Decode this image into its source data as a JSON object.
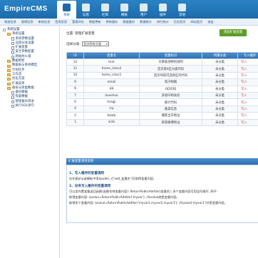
{
  "header": {
    "logo": "EmpireCMS",
    "nav": [
      {
        "label": "系统",
        "icon": "system-icon",
        "active": true
      },
      {
        "label": "信息",
        "icon": "info-icon"
      },
      {
        "label": "栏目",
        "icon": "column-icon"
      },
      {
        "label": "模板",
        "icon": "template-icon"
      },
      {
        "label": "用户",
        "icon": "user-icon"
      },
      {
        "label": "插件",
        "icon": "plugin-icon"
      },
      {
        "label": "其他",
        "icon": "other-icon"
      }
    ]
  },
  "subnav": [
    "增加信息",
    "管理信息",
    "审核信息",
    "签发信息",
    "管理评论",
    "数据更新",
    "更新缓存",
    "数据备份",
    "数据统计",
    "排行统计",
    "后台首页",
    "网站首页",
    "退出"
  ],
  "sidebar": {
    "items": [
      {
        "label": "系统设置",
        "kind": "root"
      },
      {
        "label": "系统设置",
        "kind": "folder",
        "indent": 1
      },
      {
        "label": "系统参数设置",
        "kind": "doc",
        "indent": 2
      },
      {
        "label": "远程分发设置",
        "kind": "doc",
        "indent": 2
      },
      {
        "label": "扩展变量",
        "kind": "doc",
        "indent": 2
      },
      {
        "label": "安全参数配置",
        "kind": "doc",
        "indent": 2
      },
      {
        "label": "网站防火墙",
        "kind": "doc",
        "indent": 2
      },
      {
        "label": "数据更新",
        "kind": "folder",
        "indent": 1
      },
      {
        "label": "数据表与系统模型",
        "kind": "folder",
        "indent": 1
      },
      {
        "label": "计划任务",
        "kind": "folder",
        "indent": 1
      },
      {
        "label": "工作流",
        "kind": "folder",
        "indent": 1
      },
      {
        "label": "优化方案",
        "kind": "folder",
        "indent": 1
      },
      {
        "label": "扩展菜单",
        "kind": "folder",
        "indent": 1
      },
      {
        "label": "备份与恢复数据",
        "kind": "folder",
        "indent": 1
      },
      {
        "label": "备份数据",
        "kind": "doc",
        "indent": 2
      },
      {
        "label": "恢复数据",
        "kind": "doc",
        "indent": 2
      },
      {
        "label": "管理备份目录",
        "kind": "doc",
        "indent": 2
      },
      {
        "label": "执行SQL语句",
        "kind": "doc",
        "indent": 2
      }
    ]
  },
  "main": {
    "breadcrumb": "位置: 管理扩展变量",
    "add_button": "增加扩展变量",
    "filter_label": "选择分类:",
    "filter_value": "显示所有分类",
    "columns": [
      "ID",
      "变量名",
      "变量标识",
      "所属分类",
      "写入缓存"
    ],
    "rows": [
      [
        "12",
        "text",
        "文章底部特别说明",
        "未分类",
        "写入"
      ],
      [
        "11",
        "home_class2",
        "首页第4区分类代码",
        "未分类",
        "写入"
      ],
      [
        "10",
        "home_class1",
        "首页导航可选择区的代码",
        "未分类",
        "写入"
      ],
      [
        "9",
        "email",
        "电子邮箱",
        "未分类",
        "写入"
      ],
      [
        "8",
        "qq",
        "QQ号码",
        "未分类",
        "写入"
      ],
      [
        "7",
        "duoshuo",
        "多说ID的站名",
        "未分类",
        "写入"
      ],
      [
        "6",
        "tongji",
        "统计代码",
        "未分类",
        "写入"
      ],
      [
        "4",
        "icp",
        "备案信息",
        "未分类",
        "写入"
      ],
      [
        "2",
        "bowb",
        "播客主页地址",
        "未分类",
        "写入"
      ],
      [
        "1",
        "sinb",
        "新浪微博地址",
        "未分类",
        "写入"
      ]
    ],
    "info": {
      "title": "扩展变量调用说明",
      "sections": [
        {
          "heading": "1、写入缓存的变量调用",
          "lines": [
            "在任意php或模板中用$public_r['add_变量名']可取得变量内容。"
          ]
        },
        {
          "heading": "2、没有写入缓存的变量调用",
          "lines": [
            "可以用内置变量返回函数(函数名称变量内容): ReturnPublicAddVar(变量名); 多个变量内容可用逗号隔开, 例子:",
            "取得变量内容: $value=ReturnPublicAddVar('myvar'); //$value就是变量内容。",
            "取得多个变量内容: $value=ReturnPublicAddVar('myvar1,myvar2,myvar3'); //$value['myvar1']才是变量内容。"
          ]
        }
      ]
    }
  }
}
